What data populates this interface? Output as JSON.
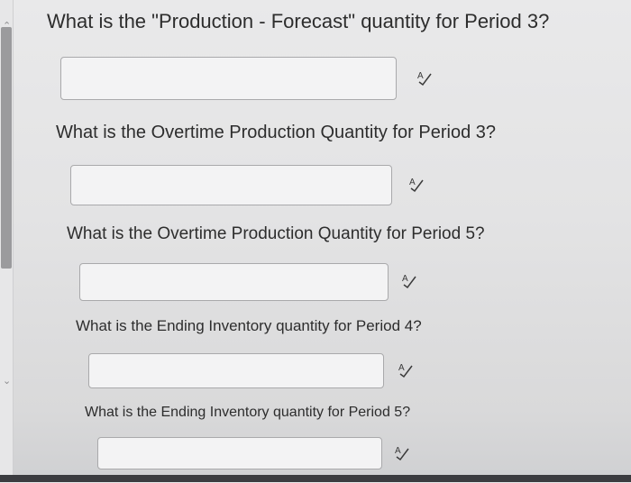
{
  "questions": [
    {
      "text": "What is the \"Production - Forecast\" quantity for Period 3?",
      "answer": "",
      "tool_icon": "spellcheck-icon"
    },
    {
      "text": "What is the Overtime Production Quantity for Period 3?",
      "answer": "",
      "tool_icon": "spellcheck-icon"
    },
    {
      "text": "What is the Overtime Production Quantity for Period 5?",
      "answer": "",
      "tool_icon": "spellcheck-icon"
    },
    {
      "text": "What is the Ending Inventory quantity for Period 4?",
      "answer": "",
      "tool_icon": "spellcheck-icon"
    },
    {
      "text": "What is the Ending Inventory quantity for Period 5?",
      "answer": "",
      "tool_icon": "spellcheck-icon"
    }
  ]
}
